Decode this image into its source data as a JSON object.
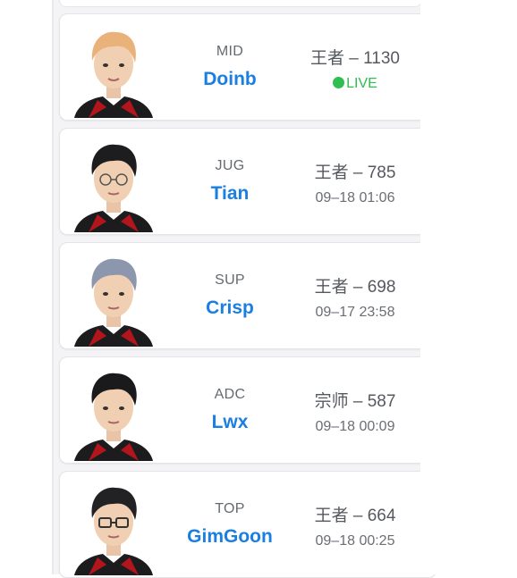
{
  "roster": [
    {
      "role": "MID",
      "name": "Doinb",
      "rank": "王者 – 1130",
      "status": "LIVE",
      "live": true,
      "hair": "#e8b27a"
    },
    {
      "role": "JUG",
      "name": "Tian",
      "rank": "王者 – 785",
      "status": "09–18 01:06",
      "live": false,
      "hair": "#1d1d1f"
    },
    {
      "role": "SUP",
      "name": "Crisp",
      "rank": "王者 – 698",
      "status": "09–17 23:58",
      "live": false,
      "hair": "#8c97ad"
    },
    {
      "role": "ADC",
      "name": "Lwx",
      "rank": "宗师 – 587",
      "status": "09–18 00:09",
      "live": false,
      "hair": "#1a1a1c"
    },
    {
      "role": "TOP",
      "name": "GimGoon",
      "rank": "王者 – 664",
      "status": "09–18 00:25",
      "live": false,
      "hair": "#222224"
    }
  ],
  "colors": {
    "name_accent": "#1a7fe0",
    "live_green": "#2fbe4f",
    "jersey_red": "#b3151c"
  }
}
